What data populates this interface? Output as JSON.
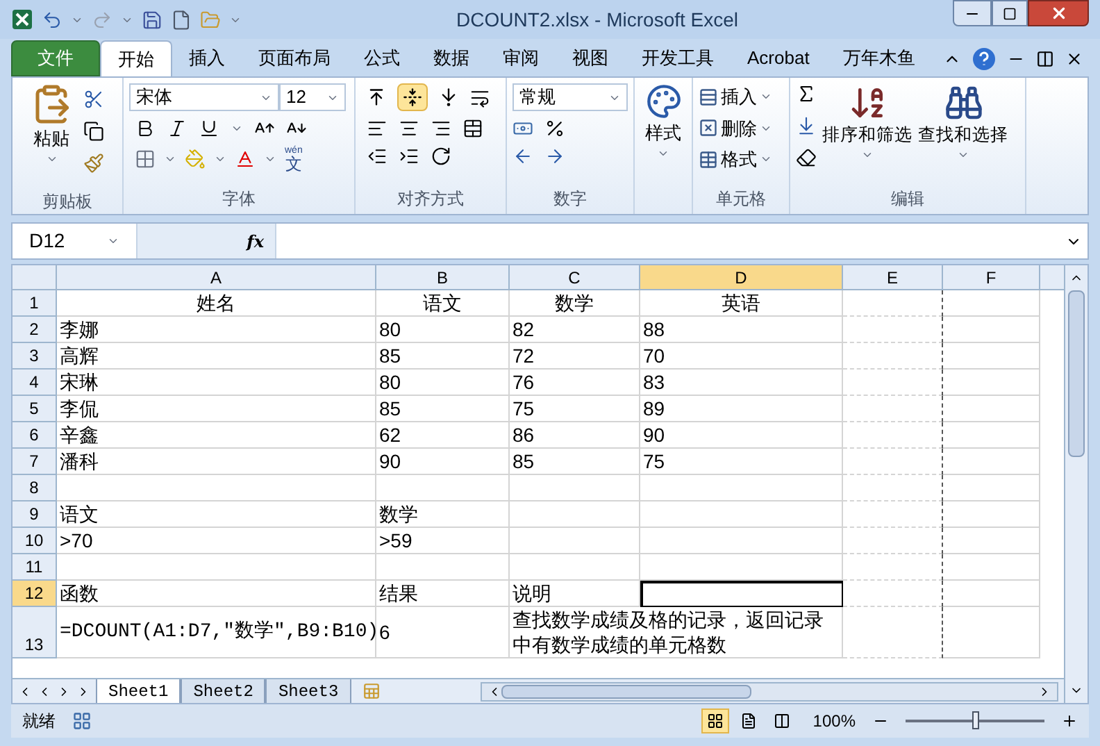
{
  "window": {
    "title": "DCOUNT2.xlsx - Microsoft Excel"
  },
  "tabs": [
    {
      "label": "文件",
      "kind": "file",
      "selected": false
    },
    {
      "label": "开始",
      "kind": "tab",
      "selected": true
    },
    {
      "label": "插入",
      "kind": "tab",
      "selected": false
    },
    {
      "label": "页面布局",
      "kind": "tab",
      "selected": false
    },
    {
      "label": "公式",
      "kind": "tab",
      "selected": false
    },
    {
      "label": "数据",
      "kind": "tab",
      "selected": false
    },
    {
      "label": "审阅",
      "kind": "tab",
      "selected": false
    },
    {
      "label": "视图",
      "kind": "tab",
      "selected": false
    },
    {
      "label": "开发工具",
      "kind": "tab",
      "selected": false
    },
    {
      "label": "Acrobat",
      "kind": "tab",
      "selected": false
    },
    {
      "label": "万年木鱼",
      "kind": "tab",
      "selected": false
    }
  ],
  "ribbon": {
    "clipboard": {
      "label": "剪贴板",
      "paste": "粘贴"
    },
    "font": {
      "label": "字体",
      "font_name": "宋体",
      "font_size": "12",
      "phonetic_annotation": "wén",
      "phonetic_glyph": "文"
    },
    "alignment": {
      "label": "对齐方式",
      "vertical": [
        {
          "kind": "top",
          "selected": false
        },
        {
          "kind": "middle",
          "selected": true
        },
        {
          "kind": "bottom",
          "selected": false
        }
      ]
    },
    "number": {
      "label": "数字",
      "format": "常规"
    },
    "styles": {
      "button": "样式"
    },
    "cells": {
      "label": "单元格",
      "items": [
        {
          "kind": "insert",
          "label": "插入"
        },
        {
          "kind": "delete",
          "label": "删除"
        },
        {
          "kind": "format",
          "label": "格式"
        }
      ]
    },
    "editing": {
      "label": "编辑",
      "sort": "排序和筛选",
      "find": "查找和选择"
    }
  },
  "formula_bar": {
    "name_box": "D12",
    "fx": "fx"
  },
  "grid": {
    "columns": [
      {
        "label": "A",
        "selected": false
      },
      {
        "label": "B",
        "selected": false
      },
      {
        "label": "C",
        "selected": false
      },
      {
        "label": "D",
        "selected": true
      },
      {
        "label": "E",
        "selected": false
      },
      {
        "label": "F",
        "selected": false
      }
    ],
    "rows": [
      {
        "number": "1",
        "kind": "header",
        "selected": false,
        "cells": {
          "A": "姓名",
          "B": "语文",
          "C": "数学",
          "D": "英语"
        }
      },
      {
        "number": "2",
        "kind": "data",
        "selected": false,
        "cells": {
          "A": "李娜",
          "B": "80",
          "C": "82",
          "D": "88"
        }
      },
      {
        "number": "3",
        "kind": "data",
        "selected": false,
        "cells": {
          "A": "高辉",
          "B": "85",
          "C": "72",
          "D": "70"
        }
      },
      {
        "number": "4",
        "kind": "data",
        "selected": false,
        "cells": {
          "A": "宋琳",
          "B": "80",
          "C": "76",
          "D": "83"
        }
      },
      {
        "number": "5",
        "kind": "data",
        "selected": false,
        "cells": {
          "A": "李侃",
          "B": "85",
          "C": "75",
          "D": "89"
        }
      },
      {
        "number": "6",
        "kind": "data",
        "selected": false,
        "cells": {
          "A": "辛鑫",
          "B": "62",
          "C": "86",
          "D": "90"
        }
      },
      {
        "number": "7",
        "kind": "data",
        "selected": false,
        "cells": {
          "A": "潘科",
          "B": "90",
          "C": "85",
          "D": "75"
        }
      },
      {
        "number": "8",
        "kind": "data",
        "selected": false,
        "cells": {}
      },
      {
        "number": "9",
        "kind": "data",
        "selected": false,
        "cells": {
          "A": "语文",
          "B": "数学"
        }
      },
      {
        "number": "10",
        "kind": "data",
        "selected": false,
        "cells": {
          "A": ">70",
          "B": ">59"
        }
      },
      {
        "number": "11",
        "kind": "data",
        "selected": false,
        "cells": {}
      },
      {
        "number": "12",
        "kind": "data",
        "selected": true,
        "cells": {
          "A": "函数",
          "B": "结果",
          "C": "说明"
        }
      },
      {
        "number": "13",
        "kind": "wrapped",
        "selected": false,
        "cells": {
          "A": "=DCOUNT(A1:D7,\"数学\",B9:B10)",
          "B": "6",
          "C": "查找数学成绩及格的记录，返回记录中有数学成绩的单元格数"
        }
      }
    ]
  },
  "sheets": [
    {
      "label": "Sheet1",
      "selected": true
    },
    {
      "label": "Sheet2",
      "selected": false
    },
    {
      "label": "Sheet3",
      "selected": false
    }
  ],
  "status_bar": {
    "state": "就绪",
    "views": [
      {
        "kind": "normal",
        "selected": true
      },
      {
        "kind": "layout",
        "selected": false
      },
      {
        "kind": "break",
        "selected": false
      }
    ],
    "zoom": "100%",
    "level": 0.5
  }
}
